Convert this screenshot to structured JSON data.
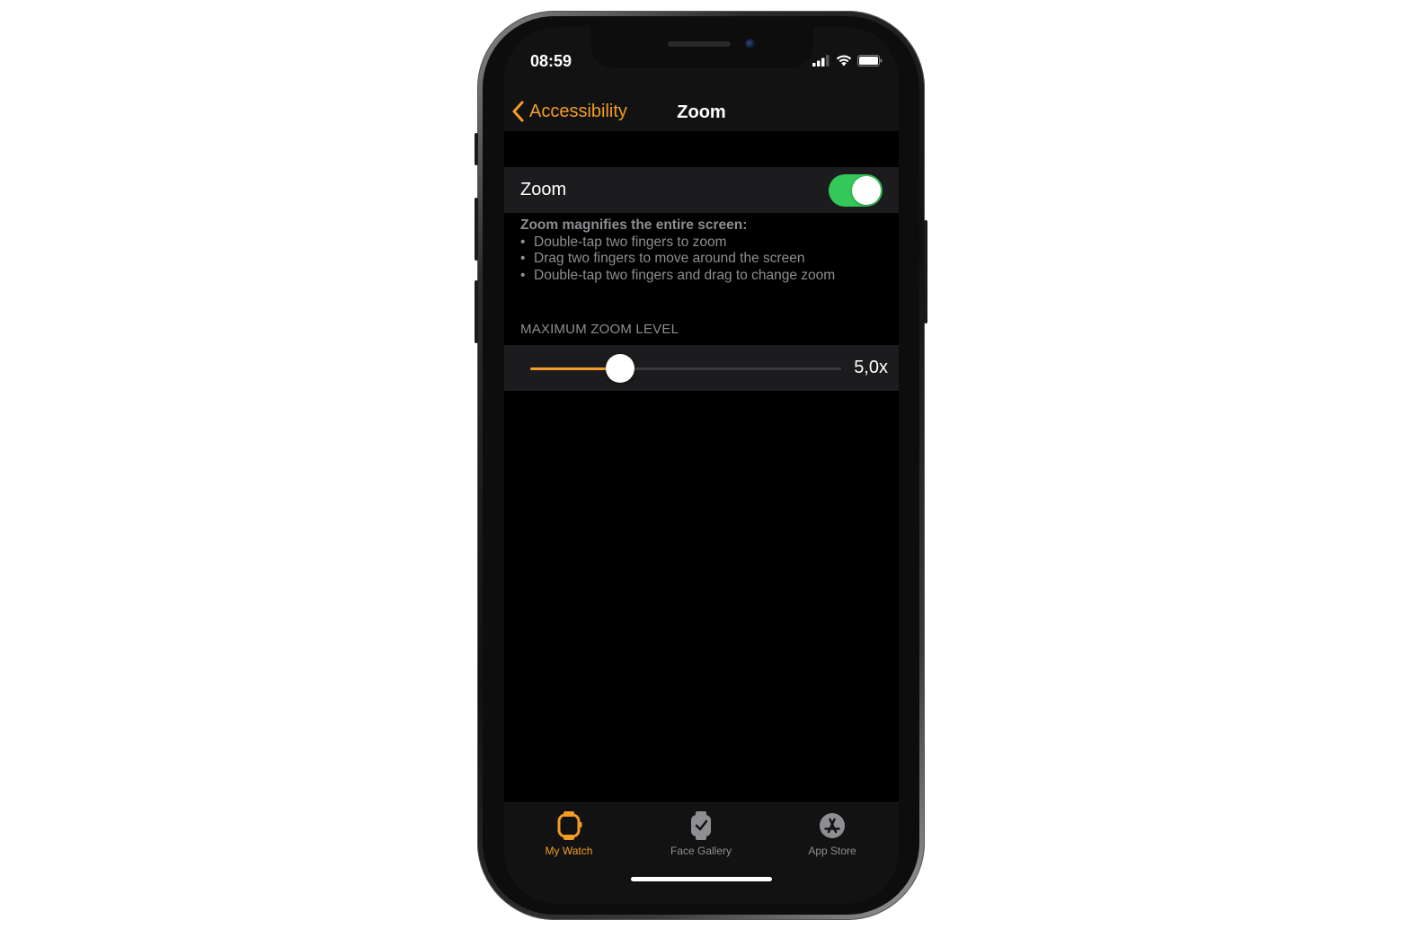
{
  "status_bar": {
    "time": "08:59",
    "signal_icon": "cellular-signal-icon",
    "wifi_icon": "wifi-icon",
    "battery_icon": "battery-icon"
  },
  "nav": {
    "back_label": "Accessibility",
    "title": "Zoom"
  },
  "zoom_cell": {
    "label": "Zoom",
    "enabled": true
  },
  "footer": {
    "heading": "Zoom magnifies the entire screen:",
    "items": [
      "Double-tap two fingers to zoom",
      "Drag two fingers to move around the screen",
      "Double-tap two fingers and drag to change zoom"
    ]
  },
  "max_zoom": {
    "header": "MAXIMUM ZOOM LEVEL",
    "value_label": "5,0x",
    "value": 5.0,
    "fraction": 0.29
  },
  "tabs": [
    {
      "label": "My Watch",
      "icon": "watch-icon",
      "active": true
    },
    {
      "label": "Face Gallery",
      "icon": "watch-face-icon",
      "active": false
    },
    {
      "label": "App Store",
      "icon": "app-store-icon",
      "active": false
    }
  ],
  "colors": {
    "accent": "#f39c26",
    "toggle_on": "#34c759",
    "background": "#000000",
    "cell": "#1c1c1e",
    "secondary_text": "#8e8e93"
  }
}
